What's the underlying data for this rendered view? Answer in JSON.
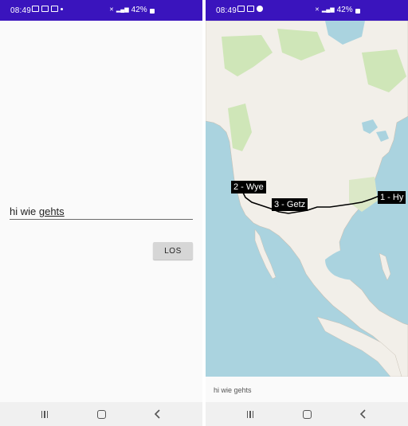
{
  "left_screen": {
    "status_bar": {
      "time": "08:49",
      "battery": "42%"
    },
    "input": {
      "value_prefix": "hi wie ",
      "value_underlined": "gehts"
    },
    "los_button": {
      "label": "LOS"
    }
  },
  "right_screen": {
    "status_bar": {
      "time": "08:49",
      "battery": "42%"
    },
    "map": {
      "route_labels": [
        "1 - Hy",
        "2 - Wye",
        "3 - Getz"
      ]
    },
    "bottom_text": "hi wie gehts"
  },
  "colors": {
    "status_bar": "#3a14bd",
    "water": "#aad3df",
    "land": "#f2efe9",
    "forest": "#cfe6b8",
    "route": "#000000",
    "button": "#d6d6d6"
  },
  "icons": [
    "gallery-icon",
    "screen-icon",
    "image-icon",
    "notification-dot-icon",
    "mute-icon",
    "signal-icon",
    "battery-icon",
    "recent-apps-icon",
    "home-icon",
    "back-icon"
  ]
}
